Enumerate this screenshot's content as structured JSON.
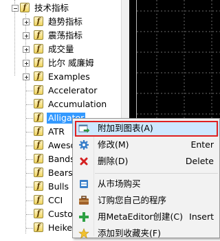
{
  "tree": {
    "root_label": "技术指标",
    "folders": [
      {
        "label": "趋势指标"
      },
      {
        "label": "震荡指标"
      },
      {
        "label": "成交量"
      },
      {
        "label": "比尔 威廉姆"
      },
      {
        "label": "Examples"
      }
    ],
    "indicators": [
      {
        "label": "Accelerator"
      },
      {
        "label": "Accumulation"
      },
      {
        "label": "Alligator"
      },
      {
        "label": "ATR"
      },
      {
        "label": "Awesome"
      },
      {
        "label": "Bands"
      },
      {
        "label": "Bears"
      },
      {
        "label": "Bulls"
      },
      {
        "label": "CCI"
      },
      {
        "label": "Custom"
      },
      {
        "label": "Heiken"
      }
    ],
    "icon_glyph": "f"
  },
  "context_menu": {
    "items": [
      {
        "label": "附加到图表(A)",
        "shortcut": "",
        "icon": "attach-to-chart-icon"
      },
      {
        "label": "修改(M)",
        "shortcut": "Enter",
        "icon": "gear-icon"
      },
      {
        "label": "删除(D)",
        "shortcut": "Delete",
        "icon": "delete-x-icon"
      },
      {
        "label": "从市场购买",
        "shortcut": "",
        "icon": "market-icon"
      },
      {
        "label": "订购您自己的程序",
        "shortcut": "",
        "icon": "briefcase-icon"
      },
      {
        "label": "用MetaEditor创建(C)",
        "shortcut": "Insert",
        "icon": "plus-icon"
      },
      {
        "label": "添加到收藏夹(F)",
        "shortcut": "",
        "icon": "star-icon"
      }
    ]
  },
  "colors": {
    "selection": "#3399ff",
    "menu_highlight": "#cde8ff",
    "annotation_box": "#e02020",
    "chart_background": "#000000"
  }
}
